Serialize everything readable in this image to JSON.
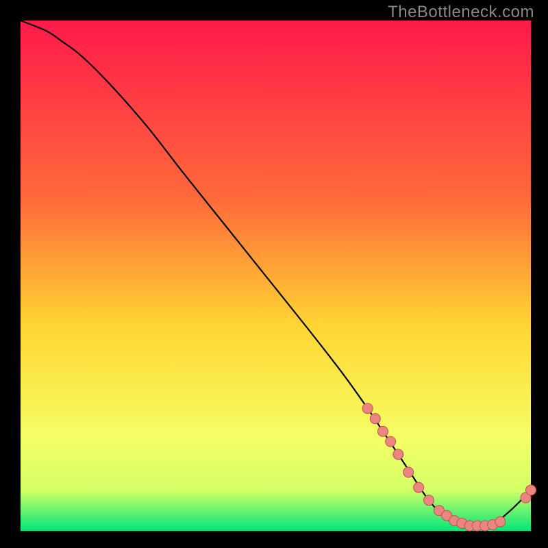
{
  "watermark": "TheBottleneck.com",
  "colors": {
    "bg": "#000000",
    "curve": "#000000",
    "dot_fill": "#e98680",
    "dot_stroke": "#c54f4f",
    "grad_top": "#ff1a4a",
    "grad_upper": "#ff6a3a",
    "grad_mid": "#ffd633",
    "grad_lower": "#d4ff66",
    "grad_bottom": "#00e67a"
  },
  "chart_data": {
    "type": "line",
    "title": "",
    "xlabel": "",
    "ylabel": "",
    "xlim": [
      0,
      100
    ],
    "ylim": [
      0,
      100
    ],
    "grid": false,
    "legend": false,
    "series": [
      {
        "name": "bottleneck-curve",
        "x": [
          0,
          5,
          8,
          12,
          18,
          25,
          32,
          40,
          48,
          56,
          63,
          68,
          72,
          76,
          80,
          84,
          88,
          92,
          96,
          100
        ],
        "y": [
          100,
          98,
          96,
          93,
          87,
          79,
          70,
          60,
          50,
          40,
          31,
          24,
          18,
          12,
          6,
          2,
          1,
          1,
          4,
          8
        ]
      }
    ],
    "highlight_points": {
      "name": "sample-dots",
      "x": [
        68,
        69.5,
        71,
        72.5,
        74,
        76,
        78,
        80,
        82,
        83.5,
        85,
        86.5,
        88,
        89.5,
        91,
        92.5,
        94,
        99,
        100
      ],
      "y": [
        24,
        22,
        19.5,
        17.5,
        15,
        11.5,
        8.5,
        6,
        4,
        3,
        2,
        1.5,
        1,
        1,
        1,
        1.2,
        1.8,
        6.5,
        8
      ]
    }
  }
}
